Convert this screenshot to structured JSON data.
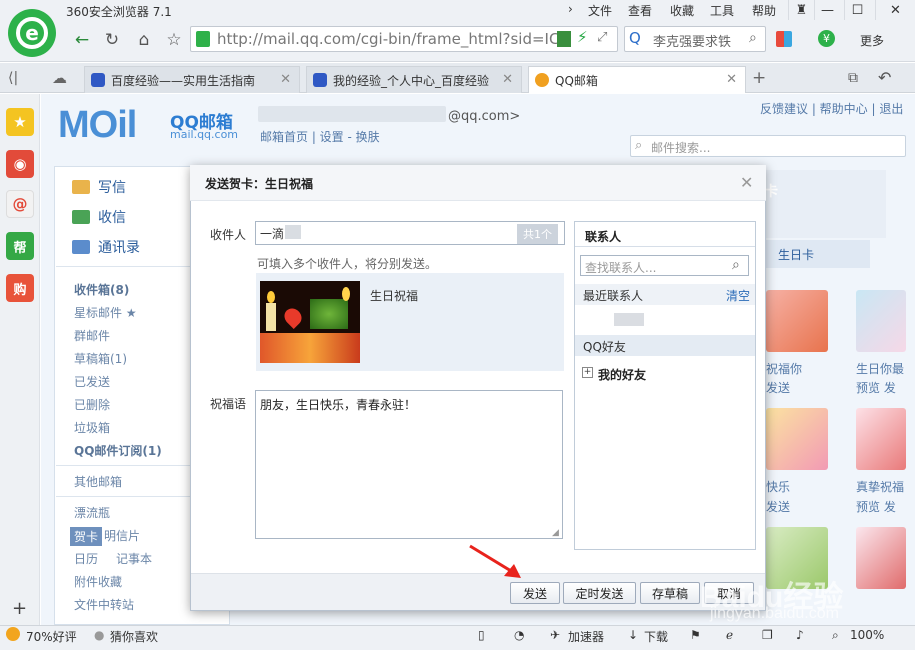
{
  "browser": {
    "title": "360安全浏览器 7.1",
    "menu": [
      "文件",
      "查看",
      "收藏",
      "工具",
      "帮助"
    ],
    "url": "http://mail.qq.com/cgi-bin/frame_html?sid=IC",
    "search_value": "李克强要求铁",
    "more_label": "更多",
    "tabs": [
      {
        "label": "百度经验——实用生活指南",
        "active": false
      },
      {
        "label": "我的经验_个人中心_百度经验",
        "active": false
      },
      {
        "label": "QQ邮箱",
        "active": true
      }
    ]
  },
  "mail": {
    "brand": "MOil",
    "brand_cn": "QQ邮箱",
    "brand_url": "mail.qq.com",
    "user_email_suffix": "@qq.com>",
    "header_links": "邮箱首页 | 设置 - 换肤",
    "top_links": "反馈建议 | 帮助中心 | 退出",
    "search_placeholder": "邮件搜索...",
    "actions": [
      "写信",
      "收信",
      "通讯录"
    ],
    "folders": [
      {
        "label": "收件箱(8)",
        "bold": true
      },
      {
        "label": "星标邮件 ★",
        "bold": false
      },
      {
        "label": "群邮件",
        "bold": false
      },
      {
        "label": "草稿箱(1)",
        "bold": false
      },
      {
        "label": "已发送",
        "bold": false
      },
      {
        "label": "已删除",
        "bold": false
      },
      {
        "label": "垃圾箱",
        "bold": false
      },
      {
        "label": "QQ邮件订阅(1)",
        "bold": true
      }
    ],
    "other_folders": "其他邮箱",
    "apps": {
      "drift": "漂流瓶",
      "card": "贺卡",
      "postcard": "明信片",
      "calendar": "日历",
      "notes": "记事本",
      "attachments": "附件收藏",
      "transfer": "文件中转站"
    },
    "right_panel": {
      "tab_label": "卡",
      "birthday_tab": "生日卡",
      "cards": [
        {
          "title": "祝福你",
          "action": "发送"
        },
        {
          "title": "生日你最",
          "action": "预览 发"
        },
        {
          "title": "快乐",
          "action": "发送"
        },
        {
          "title": "真挚祝福",
          "action": "预览 发"
        }
      ]
    }
  },
  "dialog": {
    "title": "发送贺卡：生日祝福",
    "recipient_label": "收件人",
    "recipient_value": "一滴",
    "recipient_count": "共1个",
    "recipient_hint": "可填入多个收件人，将分别发送。",
    "card_name": "生日祝福",
    "wish_label": "祝福语",
    "wish_text": "朋友，生日快乐，青春永驻！",
    "contacts": {
      "title": "联系人",
      "search_placeholder": "查找联系人...",
      "recent_label": "最近联系人",
      "clear_label": "清空",
      "qq_friends_label": "QQ好友",
      "my_friends_label": "我的好友"
    },
    "buttons": {
      "send": "发送",
      "schedule_send": "定时发送",
      "save_draft": "存草稿",
      "cancel": "取消"
    }
  },
  "statusbar": {
    "rating": "70%好评",
    "guess": "猜你喜欢",
    "accelerator": "加速器",
    "download": "下载",
    "zoom": "100%"
  },
  "watermark": {
    "main": "Baidu经验",
    "sub": "jingyan.baidu.com"
  }
}
